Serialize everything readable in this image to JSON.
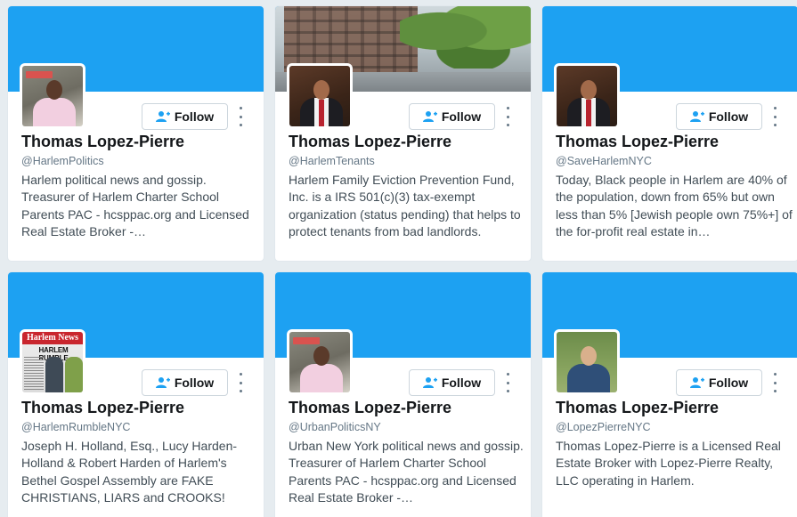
{
  "colors": {
    "banner": "#1da1f2",
    "page_bg": "#e6ecf0",
    "name_text": "#14171a",
    "meta_text": "#657786"
  },
  "icons": {
    "follow": "add-user-icon",
    "more": "more-vertical-icon"
  },
  "cards": [
    {
      "name": "Thomas Lopez-Pierre",
      "handle": "@HarlemPolitics",
      "follow_label": "Follow",
      "bio": "Harlem political news and gossip. Treasurer of Harlem Charter School Parents PAC - hcsppac.org and Licensed Real Estate Broker -…"
    },
    {
      "name": "Thomas Lopez-Pierre",
      "handle": "@HarlemTenants",
      "follow_label": "Follow",
      "bio": "Harlem Family Eviction Prevention Fund, Inc. is a IRS 501(c)(3) tax-exempt organization (status pending) that helps to protect tenants from bad landlords."
    },
    {
      "name": "Thomas Lopez-Pierre",
      "handle": "@SaveHarlemNYC",
      "follow_label": "Follow",
      "bio": "Today, Black people in Harlem are 40% of the population, down from 65% but own less than 5% [Jewish people own 75%+] of the for-profit real estate in…"
    },
    {
      "name": "Thomas Lopez-Pierre",
      "handle": "@HarlemRumbleNYC",
      "follow_label": "Follow",
      "bio": "Joseph H. Holland, Esq., Lucy Harden-Holland & Robert Harden of Harlem's Bethel Gospel Assembly are FAKE CHRISTIANS, LIARS and CROOKS!",
      "avatar_headline_top": "Harlem News",
      "avatar_headline": "HARLEM RUMBLE"
    },
    {
      "name": "Thomas Lopez-Pierre",
      "handle": "@UrbanPoliticsNY",
      "follow_label": "Follow",
      "bio": "Urban New York political news and gossip. Treasurer of Harlem Charter School Parents PAC - hcsppac.org and Licensed Real Estate Broker -…"
    },
    {
      "name": "Thomas Lopez-Pierre",
      "handle": "@LopezPierreNYC",
      "follow_label": "Follow",
      "bio": "Thomas Lopez-Pierre is a Licensed Real Estate Broker with Lopez-Pierre Realty, LLC operating in Harlem."
    }
  ]
}
